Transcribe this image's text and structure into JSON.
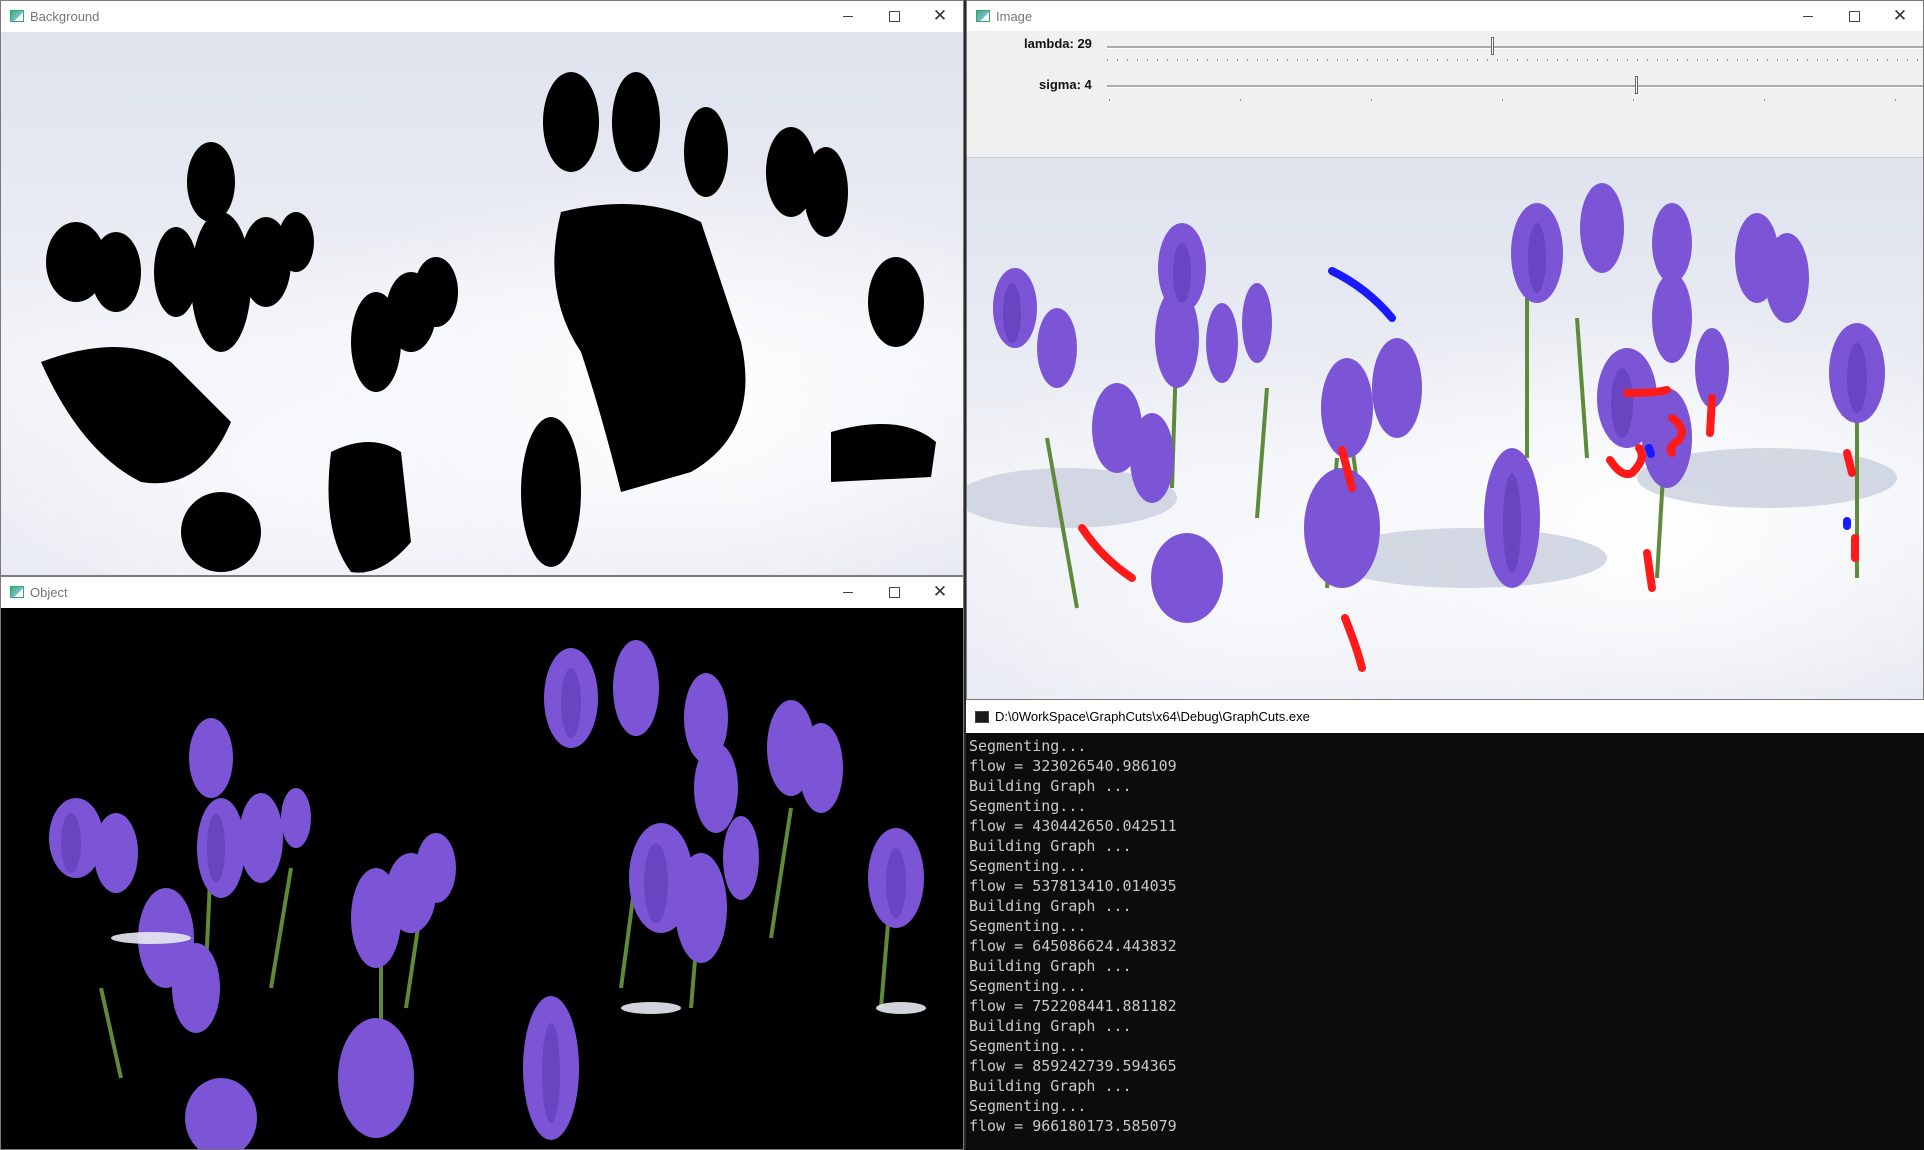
{
  "windows": {
    "background": {
      "title": "Background"
    },
    "object": {
      "title": "Object"
    },
    "image": {
      "title": "Image",
      "trackbars": [
        {
          "label": "lambda: 29",
          "value": 29
        },
        {
          "label": "sigma: 4",
          "value": 4
        }
      ]
    },
    "console": {
      "title": "D:\\0WorkSpace\\GraphCuts\\x64\\Debug\\GraphCuts.exe",
      "lines": [
        "Segmenting...",
        "flow = 323026540.986109",
        "Building Graph ...",
        "Segmenting...",
        "flow = 430442650.042511",
        "Building Graph ...",
        "Segmenting...",
        "flow = 537813410.014035",
        "Building Graph ...",
        "Segmenting...",
        "flow = 645086624.443832",
        "Building Graph ...",
        "Segmenting...",
        "flow = 752208441.881182",
        "Building Graph ...",
        "Segmenting...",
        "flow = 859242739.594365",
        "Building Graph ...",
        "Segmenting...",
        "flow = 966180173.585079"
      ]
    }
  },
  "colors": {
    "flower": "#7b55d6",
    "flower_dark": "#5a3bb0",
    "stroke_foreground": "#ff1a1a",
    "stroke_background": "#1a1aff",
    "console_bg": "#0c0c0c",
    "console_text": "#c8c8c8"
  },
  "icons": [
    "window-icon",
    "minimize-icon",
    "maximize-icon",
    "close-icon",
    "console-icon"
  ]
}
